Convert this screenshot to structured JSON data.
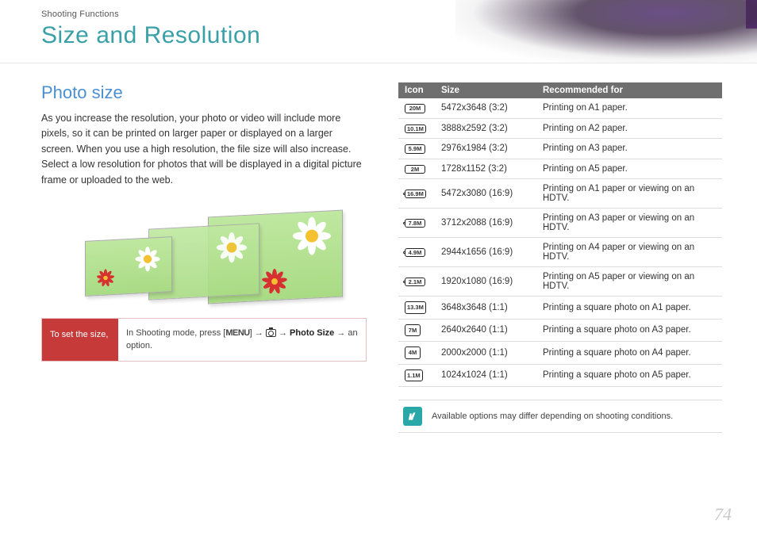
{
  "header": {
    "breadcrumb": "Shooting Functions",
    "title": "Size and Resolution"
  },
  "section": {
    "heading": "Photo size",
    "body": "As you increase the resolution, your photo or video will include more pixels, so it can be printed on larger paper or displayed on a larger screen. When you use a high resolution, the file size will also increase. Select a low resolution for photos that will be displayed in a digital picture frame or uploaded to the web."
  },
  "instruction": {
    "label": "To set the size,",
    "prefix": "In Shooting mode, press [",
    "menu": "MENU",
    "mid": "] → ",
    "arrow2": " → ",
    "bold": "Photo Size",
    "suffix": " → an option."
  },
  "table": {
    "headers": {
      "icon": "Icon",
      "size": "Size",
      "rec": "Recommended for"
    },
    "rows": [
      {
        "mp": "20M",
        "cls": "",
        "size": "5472x3648 (3:2)",
        "rec": "Printing on A1 paper."
      },
      {
        "mp": "10.1M",
        "cls": "",
        "size": "3888x2592 (3:2)",
        "rec": "Printing on A2 paper."
      },
      {
        "mp": "5.9M",
        "cls": "",
        "size": "2976x1984 (3:2)",
        "rec": "Printing on A3 paper."
      },
      {
        "mp": "2M",
        "cls": "",
        "size": "1728x1152 (3:2)",
        "rec": "Printing on A5 paper."
      },
      {
        "mp": "16.9M",
        "cls": "wide",
        "size": "5472x3080 (16:9)",
        "rec": "Printing on A1 paper or viewing on an HDTV."
      },
      {
        "mp": "7.8M",
        "cls": "wide",
        "size": "3712x2088 (16:9)",
        "rec": "Printing on A3 paper or viewing on an HDTV."
      },
      {
        "mp": "4.9M",
        "cls": "wide",
        "size": "2944x1656 (16:9)",
        "rec": "Printing on A4 paper or viewing on an HDTV."
      },
      {
        "mp": "2.1M",
        "cls": "wide",
        "size": "1920x1080 (16:9)",
        "rec": "Printing on A5 paper or viewing on an HDTV."
      },
      {
        "mp": "13.3M",
        "cls": "sq",
        "size": "3648x3648 (1:1)",
        "rec": "Printing a square photo on A1 paper."
      },
      {
        "mp": "7M",
        "cls": "sq",
        "size": "2640x2640 (1:1)",
        "rec": "Printing a square photo on A3 paper."
      },
      {
        "mp": "4M",
        "cls": "sq",
        "size": "2000x2000 (1:1)",
        "rec": "Printing a square photo on A4 paper."
      },
      {
        "mp": "1.1M",
        "cls": "sq",
        "size": "1024x1024 (1:1)",
        "rec": "Printing a square photo on A5 paper."
      }
    ]
  },
  "note": "Available options may differ depending on shooting conditions.",
  "page_number": "74"
}
